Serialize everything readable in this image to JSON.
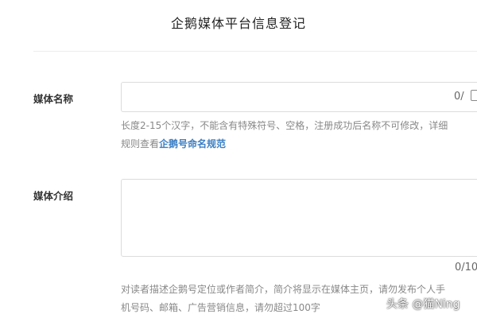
{
  "page": {
    "title": "企鹅媒体平台信息登记"
  },
  "media_name": {
    "label": "媒体名称",
    "counter": "0/",
    "hint_line1": "长度2-15个汉字，不能含有特殊符号、空格，注册成功后名称不可修改，详细",
    "hint_line2_prefix": "规则查看",
    "hint_link": "企鹅号命名规范"
  },
  "media_intro": {
    "label": "媒体介绍",
    "counter": "0/10",
    "hint_line1": "对读者描述企鹅号定位或作者简介，简介将显示在媒体主页，请勿发布个人手",
    "hint_line2": "机号码、邮箱、广告营销信息，请勿超过100字"
  },
  "watermark": {
    "text": "头条 @猫Ning"
  }
}
